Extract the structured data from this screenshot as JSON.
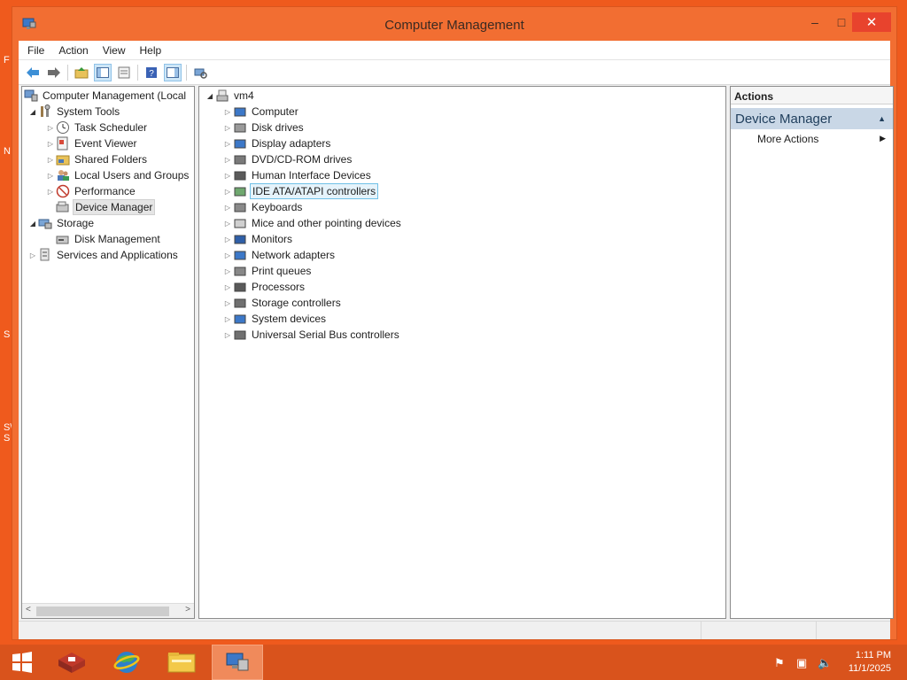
{
  "window": {
    "title": "Computer Management",
    "controls": {
      "minimize": "–",
      "maximize": "□",
      "close": "✕"
    }
  },
  "menu": [
    "File",
    "Action",
    "View",
    "Help"
  ],
  "toolbar_icons": [
    "back-arrow-icon",
    "forward-arrow-icon",
    "up-folder-icon",
    "show-hide-tree-icon",
    "properties-icon",
    "help-icon",
    "action-pane-icon",
    "device-scan-icon"
  ],
  "left_tree": {
    "root": "Computer Management (Local",
    "system_tools": "System Tools",
    "system_tools_children": [
      "Task Scheduler",
      "Event Viewer",
      "Shared Folders",
      "Local Users and Groups",
      "Performance",
      "Device Manager"
    ],
    "storage": "Storage",
    "storage_children": [
      "Disk Management"
    ],
    "services": "Services and Applications"
  },
  "device_tree": {
    "root": "vm4",
    "categories": [
      "Computer",
      "Disk drives",
      "Display adapters",
      "DVD/CD-ROM drives",
      "Human Interface Devices",
      "IDE ATA/ATAPI controllers",
      "Keyboards",
      "Mice and other pointing devices",
      "Monitors",
      "Network adapters",
      "Print queues",
      "Processors",
      "Storage controllers",
      "System devices",
      "Universal Serial Bus controllers"
    ],
    "selected": "IDE ATA/ATAPI controllers"
  },
  "actions": {
    "header": "Actions",
    "section": "Device Manager",
    "item": "More Actions"
  },
  "taskbar": {
    "time": "1:11 PM",
    "date": "11/1/2025"
  },
  "colors": {
    "desktop": "#ef5a1d",
    "window_frame": "#f26e32",
    "close_button": "#e8432d",
    "selection": "#e5f3fb",
    "taskbar": "#d9531c"
  }
}
